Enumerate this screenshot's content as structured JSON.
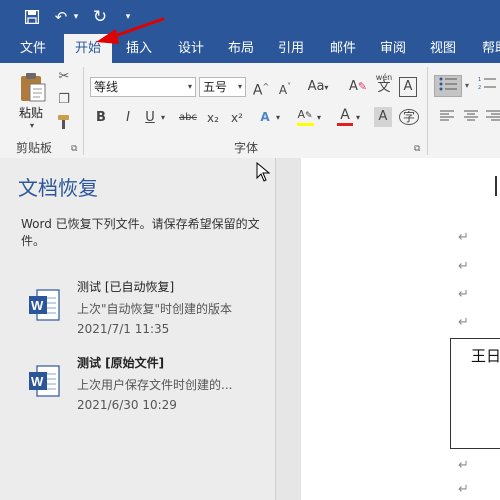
{
  "quick_access": {
    "save_icon": "save-icon",
    "undo_icon": "undo-icon",
    "redo_icon": "redo-icon",
    "more_icon": "customize-toolbar-icon"
  },
  "tabs": [
    "文件",
    "开始",
    "插入",
    "设计",
    "布局",
    "引用",
    "邮件",
    "审阅",
    "视图",
    "帮助"
  ],
  "active_tab": "开始",
  "ribbon": {
    "clipboard": {
      "paste_label": "粘贴",
      "group_label": "剪贴板"
    },
    "font": {
      "font_name": "等线",
      "font_size": "五号",
      "grow_label": "A",
      "shrink_label": "A",
      "case_label": "Aa",
      "clear_label": "A",
      "phonetic_label": "wén",
      "border_label": "A",
      "bold_label": "B",
      "italic_label": "I",
      "underline_label": "U",
      "strike_label": "abc",
      "sub_label": "x₂",
      "sup_label": "x²",
      "color_label": "A",
      "shade_label": "A",
      "group_label": "字体"
    },
    "accent_colors": {
      "highlight": "#ffff00",
      "font_color": "#e02020",
      "brand": "#2b579a"
    }
  },
  "recovery": {
    "title": "文档恢复",
    "description": "Word 已恢复下列文件。请保存希望保留的文件。",
    "files": [
      {
        "name": "测试  [已自动恢复]",
        "desc": "上次\"自动恢复\"时创建的版本",
        "date": "2021/7/1 11:35"
      },
      {
        "name": "测试  [原始文件]",
        "desc": "上次用户保存文件时创建的...",
        "date": "2021/6/30 10:29"
      }
    ]
  },
  "document": {
    "paragraph_mark": "↵",
    "table_text": "王日"
  }
}
